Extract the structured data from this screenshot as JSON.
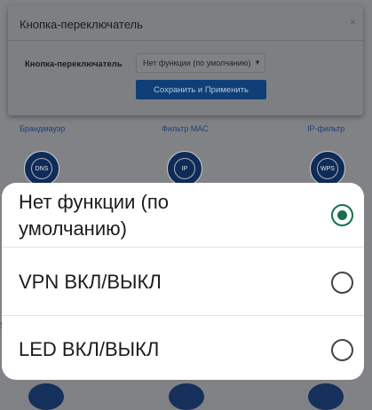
{
  "background": {
    "top_labels": [
      "",
      "",
      "",
      ""
    ],
    "features": [
      {
        "label": "Брандмауэр",
        "icon": "globe-icon",
        "icon_text": "DNS"
      },
      {
        "label": "Фильтр MAC",
        "icon": "ip-icon",
        "icon_text": "IP"
      },
      {
        "label": "IP-фильтр",
        "icon": "wps-icon",
        "icon_text": "WPS"
      }
    ],
    "edge_letter": "S"
  },
  "dialog": {
    "title": "Кнопка-переключатель",
    "close_symbol": "×",
    "field_label": "Кнопка-переключатель",
    "select_value": "Нет функции (по умолчанию)",
    "apply_label": "Сохранить и Применить"
  },
  "picker": {
    "options": [
      {
        "label_line1": "Нет функции (по",
        "label_line2": "умолчанию)",
        "selected": true
      },
      {
        "label": "VPN ВКЛ/ВЫКЛ",
        "selected": false
      },
      {
        "label": "LED ВКЛ/ВЫКЛ",
        "selected": false
      }
    ],
    "accent_color": "#15724a"
  }
}
